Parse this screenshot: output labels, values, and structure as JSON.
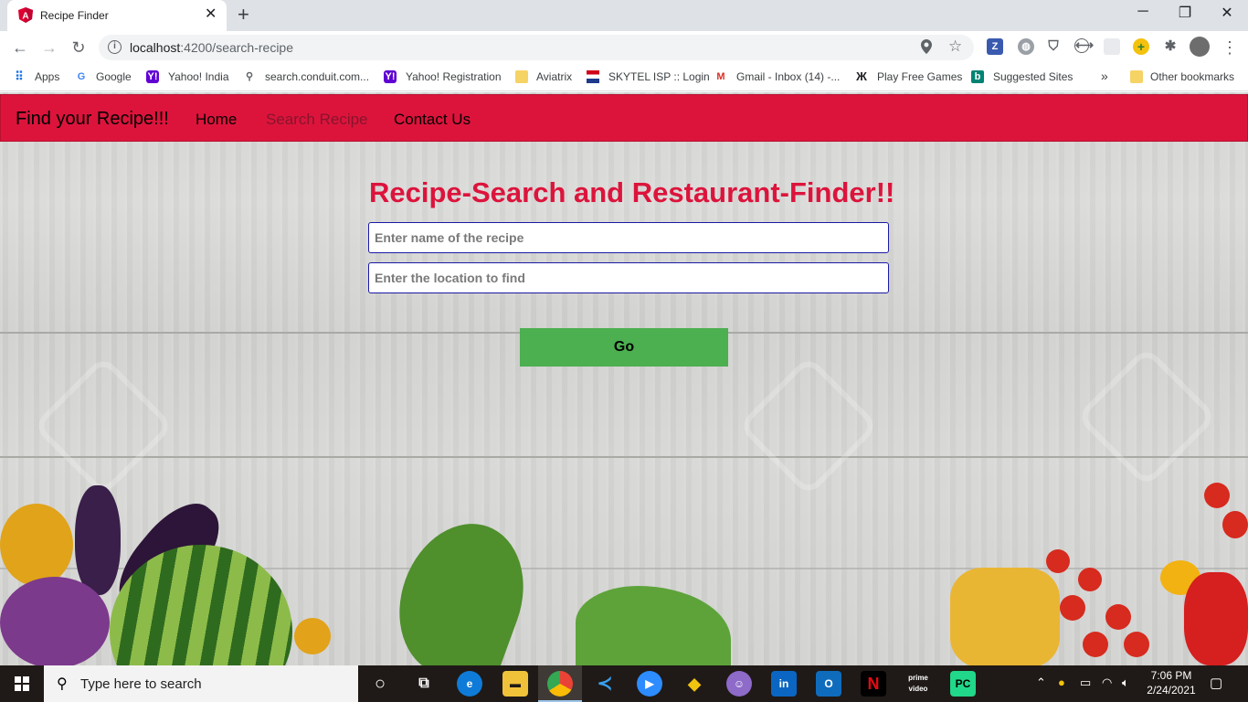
{
  "browser": {
    "tab_title": "Recipe Finder",
    "tab_close": "✕",
    "new_tab": "+",
    "window_controls": [
      "─",
      "❐",
      "✕"
    ],
    "url_host": "localhost",
    "url_rest": ":4200/search-recipe",
    "back": "←",
    "forward": "→",
    "reload": "↻",
    "menu": "⋮"
  },
  "bookmarks": {
    "items": [
      {
        "label": "Apps",
        "icon": "apps-grid-icon"
      },
      {
        "label": "Google",
        "icon": "google-icon"
      },
      {
        "label": "Yahoo! India",
        "icon": "yahoo-icon"
      },
      {
        "label": "search.conduit.com...",
        "icon": "search-icon"
      },
      {
        "label": "Yahoo! Registration",
        "icon": "yahoo-icon"
      },
      {
        "label": "Aviatrix",
        "icon": "folder-icon"
      },
      {
        "label": "SKYTEL ISP :: Login",
        "icon": "flag-icon"
      },
      {
        "label": "Gmail - Inbox (14) -...",
        "icon": "gmail-icon"
      },
      {
        "label": "Play Free Games",
        "icon": "games-icon"
      },
      {
        "label": "Suggested Sites",
        "icon": "bing-icon"
      }
    ],
    "overflow": "»",
    "other": "Other bookmarks"
  },
  "navbar": {
    "brand": "Find your Recipe!!!",
    "links": [
      "Home",
      "Search Recipe",
      "Contact Us"
    ],
    "active": "Search Recipe"
  },
  "main": {
    "heading": "Recipe-Search and Restaurant-Finder!!",
    "recipe_placeholder": "Enter name of the recipe",
    "location_placeholder": "Enter the location to find",
    "go_label": "Go"
  },
  "taskbar": {
    "search_placeholder": "Type here to search",
    "time": "7:06 PM",
    "date": "2/24/2021"
  },
  "colors": {
    "navbar": "#dc143c",
    "heading": "#dc143c",
    "go_button": "#4caf50"
  }
}
